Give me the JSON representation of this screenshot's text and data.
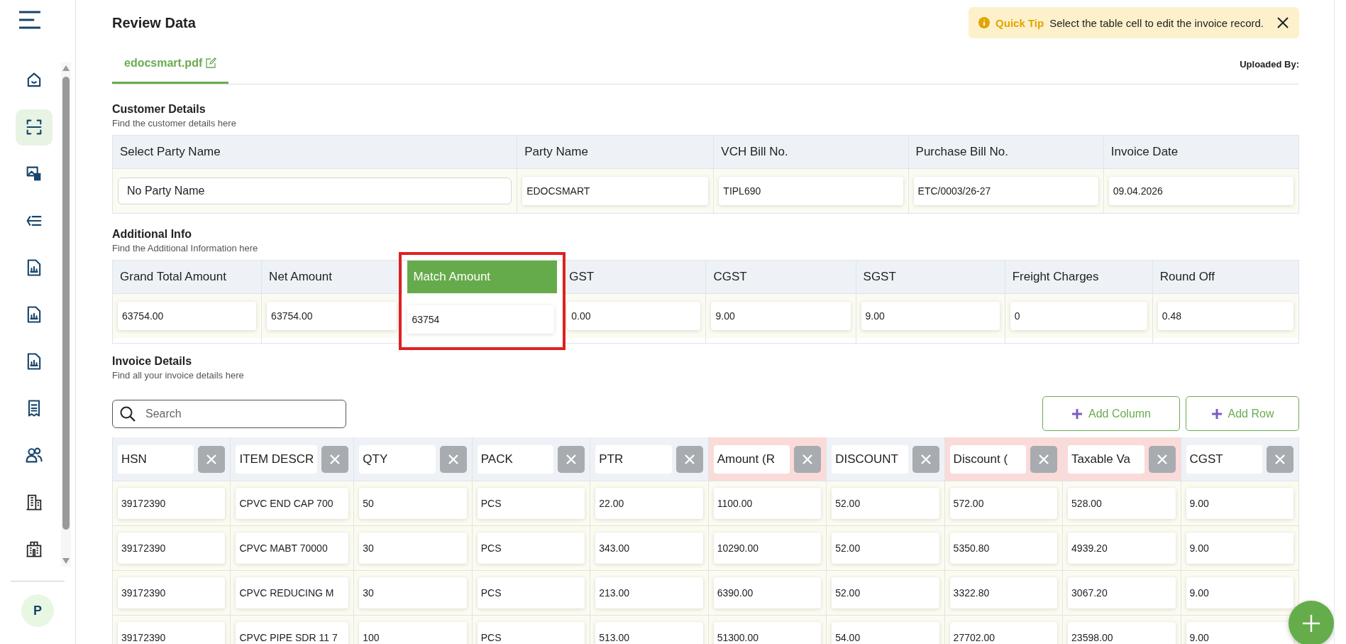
{
  "sidebar": {
    "items": [
      {
        "kind": "home",
        "selected": false
      },
      {
        "kind": "scan",
        "selected": true
      },
      {
        "kind": "images",
        "selected": false
      },
      {
        "kind": "list",
        "selected": false
      },
      {
        "kind": "report",
        "selected": false
      },
      {
        "kind": "report",
        "selected": false
      },
      {
        "kind": "report",
        "selected": false
      },
      {
        "kind": "receipt",
        "selected": false
      },
      {
        "kind": "users",
        "selected": false
      },
      {
        "kind": "building",
        "selected": false
      },
      {
        "kind": "hospital",
        "selected": false
      }
    ],
    "avatar": {
      "initial": "P"
    }
  },
  "header": {
    "title": "Review Data"
  },
  "quick_tip": {
    "label": "Quick Tip",
    "message": "Select the table cell to edit the invoice record."
  },
  "file_tabs": [
    {
      "label": "edocsmart.pdf",
      "selected": true
    }
  ],
  "uploaded_by": "Uploaded By:",
  "customer_details": {
    "title": "Customer Details",
    "subtitle": "Find the customer details here",
    "fields": [
      {
        "label": "Select Party Name",
        "value": "No Party Name",
        "kind": "select"
      },
      {
        "label": "Party Name",
        "value": "EDOCSMART",
        "kind": "text"
      },
      {
        "label": "VCH Bill No.",
        "value": "TIPL690",
        "kind": "text"
      },
      {
        "label": "Purchase Bill No.",
        "value": "ETC/0003/26-27",
        "kind": "text"
      },
      {
        "label": "Invoice Date",
        "value": "09.04.2026",
        "kind": "text"
      }
    ]
  },
  "additional_info": {
    "title": "Additional Info",
    "subtitle": "Find the Additional Information here",
    "fields": [
      {
        "label": "Grand Total Amount",
        "value": "63754.00",
        "highlighted": false
      },
      {
        "label": "Net Amount",
        "value": "63754.00",
        "highlighted": false
      },
      {
        "label": "Match Amount",
        "value": "63754",
        "highlighted": true
      },
      {
        "label": "GST",
        "value": "0.00",
        "highlighted": false
      },
      {
        "label": "CGST",
        "value": "9.00",
        "highlighted": false
      },
      {
        "label": "SGST",
        "value": "9.00",
        "highlighted": false
      },
      {
        "label": "Freight Charges",
        "value": "0",
        "highlighted": false
      },
      {
        "label": "Round Off",
        "value": "0.48",
        "highlighted": false
      }
    ]
  },
  "invoice_details": {
    "title": "Invoice Details",
    "subtitle": "Find all your invoice details here",
    "search": {
      "placeholder": "Search"
    },
    "buttons": [
      {
        "label": "Add Column"
      },
      {
        "label": "Add Row"
      }
    ],
    "columns": [
      {
        "name": "HSN",
        "flagged": false
      },
      {
        "name": "ITEM DESCR",
        "flagged": false
      },
      {
        "name": "QTY",
        "flagged": false
      },
      {
        "name": "PACK",
        "flagged": false
      },
      {
        "name": "PTR",
        "flagged": false
      },
      {
        "name": "Amount (R",
        "flagged": true
      },
      {
        "name": "DISCOUNT",
        "flagged": false
      },
      {
        "name": "Discount (",
        "flagged": true
      },
      {
        "name": "Taxable Va",
        "flagged": true
      },
      {
        "name": "CGST",
        "flagged": false
      }
    ],
    "rows": [
      [
        "39172390",
        "CPVC END CAP 700",
        "50",
        "PCS",
        "22.00",
        "1100.00",
        "52.00",
        "572.00",
        "528.00",
        "9.00"
      ],
      [
        "39172390",
        "CPVC MABT 70000",
        "30",
        "PCS",
        "343.00",
        "10290.00",
        "52.00",
        "5350.80",
        "4939.20",
        "9.00"
      ],
      [
        "39172390",
        "CPVC REDUCING M",
        "30",
        "PCS",
        "213.00",
        "6390.00",
        "52.00",
        "3322.80",
        "3067.20",
        "9.00"
      ],
      [
        "39172390",
        "CPVC PIPE SDR 11 7",
        "100",
        "PCS",
        "513.00",
        "51300.00",
        "54.00",
        "27702.00",
        "23598.00",
        "9.00"
      ]
    ]
  }
}
